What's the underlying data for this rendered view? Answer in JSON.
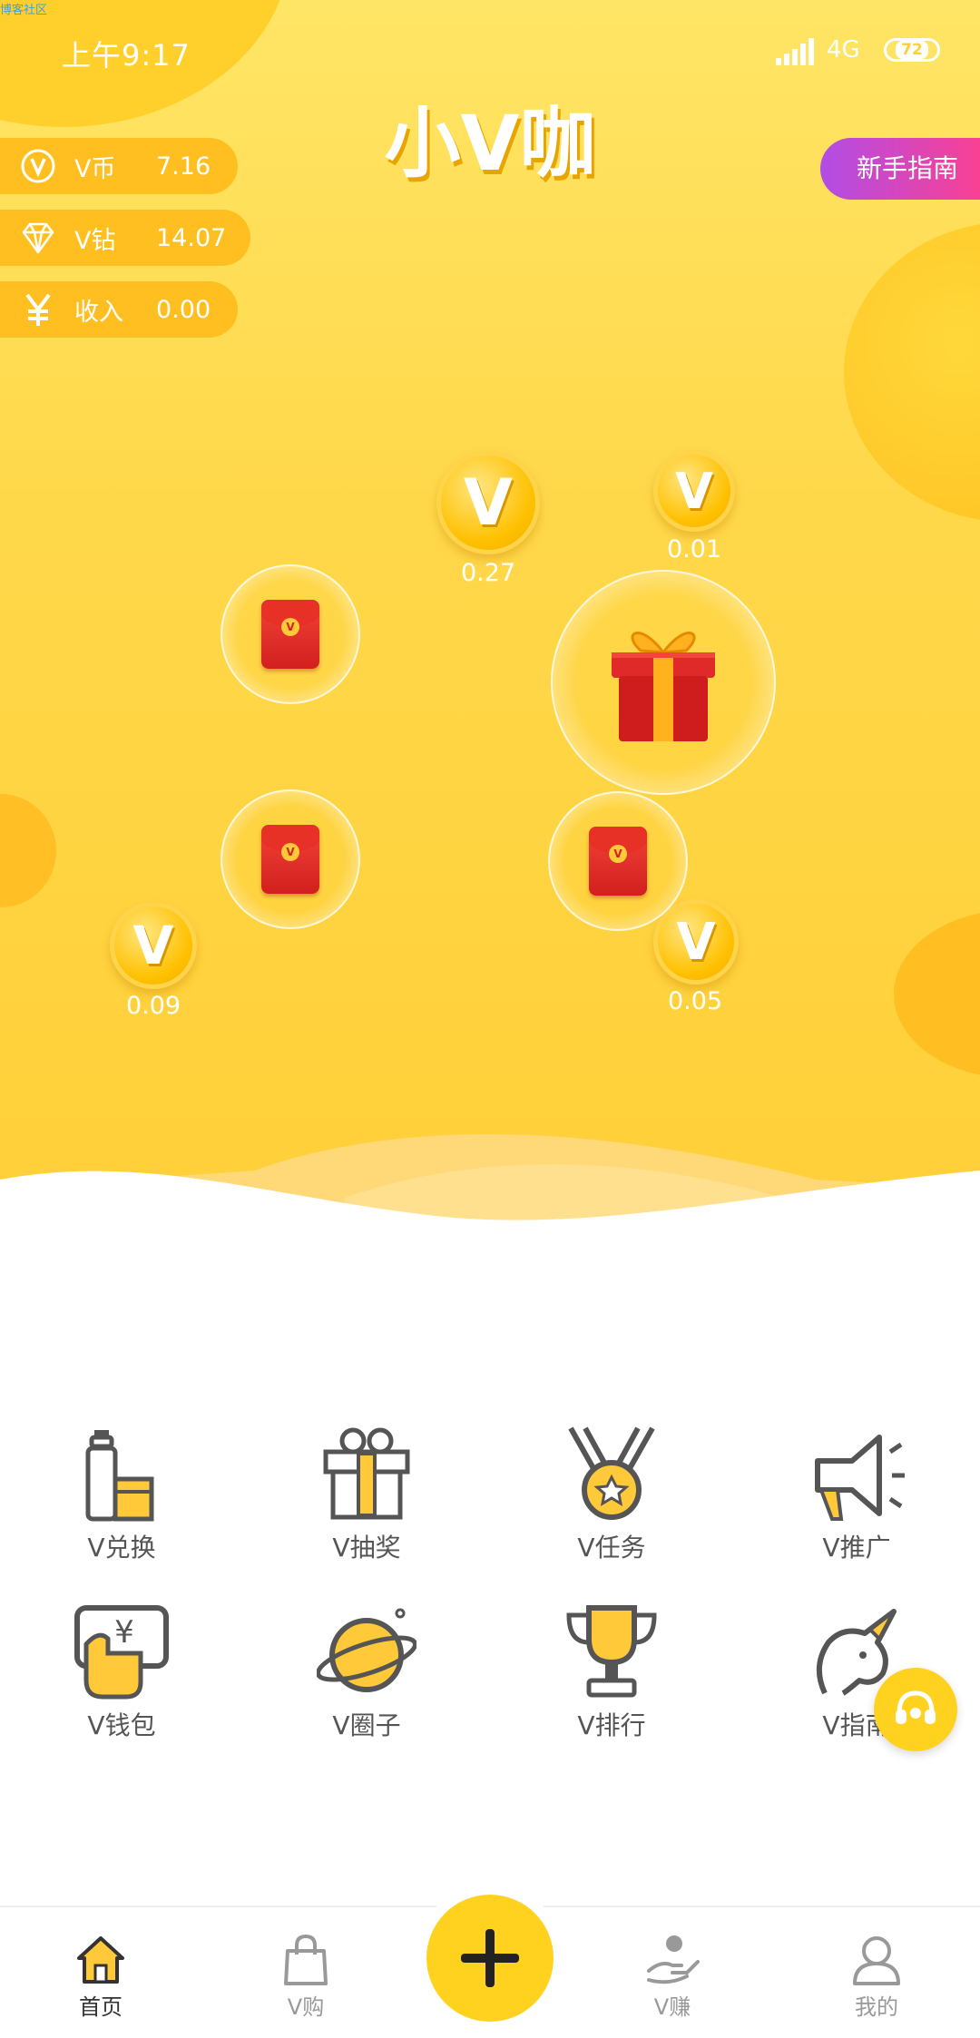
{
  "watermark": "博客社区",
  "status_bar": {
    "time": "上午9:17",
    "network": "4G",
    "battery": "72"
  },
  "app": {
    "logo_text": "小V咖"
  },
  "balances": {
    "coin": {
      "label": "V币",
      "value": "7.16",
      "icon": "v-coin-icon"
    },
    "diamond": {
      "label": "V钻",
      "value": "14.07",
      "icon": "diamond-icon"
    },
    "income": {
      "label": "收入",
      "value": "0.00",
      "icon": "yuan-icon"
    }
  },
  "guide_button": "新手指南",
  "collectibles": {
    "coins": [
      {
        "value": "0.27"
      },
      {
        "value": "0.01"
      },
      {
        "value": "0.09"
      },
      {
        "value": "0.05"
      }
    ],
    "coin_glyph": "V",
    "envelope_glyph": "V"
  },
  "features": [
    {
      "label": "V兑换",
      "icon": "exchange-icon"
    },
    {
      "label": "V抽奖",
      "icon": "gift-lottery-icon"
    },
    {
      "label": "V任务",
      "icon": "medal-task-icon"
    },
    {
      "label": "V推广",
      "icon": "megaphone-icon"
    },
    {
      "label": "V钱包",
      "icon": "wallet-icon"
    },
    {
      "label": "V圈子",
      "icon": "planet-icon"
    },
    {
      "label": "V排行",
      "icon": "trophy-icon"
    },
    {
      "label": "V指南",
      "icon": "unicorn-icon"
    }
  ],
  "tabbar": {
    "items": [
      {
        "label": "首页",
        "icon": "home-icon",
        "active": true
      },
      {
        "label": "V购",
        "icon": "shopping-bag-icon",
        "active": false
      },
      {
        "label": "V赚",
        "icon": "earn-hand-icon",
        "active": false
      },
      {
        "label": "我的",
        "icon": "profile-icon",
        "active": false
      }
    ],
    "add_icon": "plus-icon"
  },
  "colors": {
    "brand_yellow": "#ffd21f",
    "hero_yellow": "#ffd84a",
    "pill": "#ffbf20",
    "guide_gradient_start": "#b14de6",
    "guide_gradient_end": "#ff3f8d",
    "envelope_red": "#e83126"
  }
}
